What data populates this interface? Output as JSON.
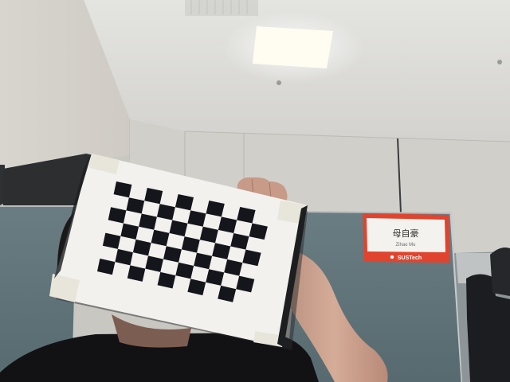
{
  "scene": {
    "description_free": true,
    "board": {
      "rows": 7,
      "cols": 10,
      "square_color": "#15151c",
      "paper_color": "#f2f1ee"
    },
    "nameplate": {
      "name": "母自豪",
      "subname": "Zihao Mu",
      "logo_text": "SUSTech",
      "frame_color": "#e0442e"
    },
    "colors": {
      "wall": "#c9c7c2",
      "ceiling": "#ddddd9",
      "partition": "#617479",
      "light": "#fffdf2",
      "skin": "#c9a08d",
      "shirt": "#121214"
    }
  }
}
